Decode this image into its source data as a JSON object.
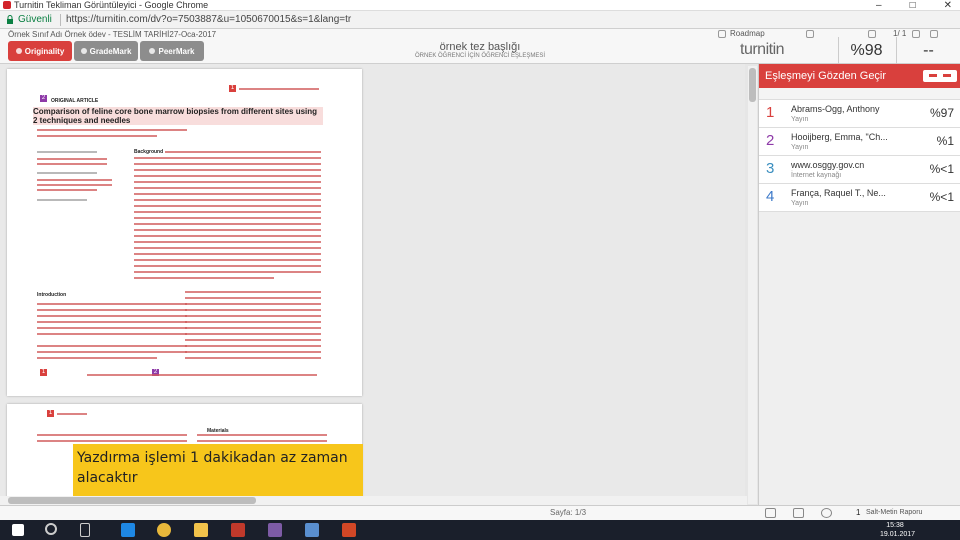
{
  "browser": {
    "window_title": "Turnitin Tekliman Görüntüleyici - Google Chrome",
    "secure_label": "Güvenli",
    "url": "https://turnitin.com/dv?o=7503887&u=1050670015&s=1&lang=tr"
  },
  "header": {
    "meta": "Örnek Sınıf Adı    Örnek ödev - TESLİM TARİHİ27-Oca-2017",
    "tabs": [
      {
        "label": "Originality",
        "active": true
      },
      {
        "label": "GradeMark",
        "active": false
      },
      {
        "label": "PeerMark",
        "active": false
      }
    ],
    "doc_title": "örnek tez başlığı",
    "doc_subtitle": "ÖRNEK ÖĞRENCİ İÇİN ÖĞRENCİ EŞLEŞMESİ",
    "roadmap_label": "Roadmap",
    "page_indicator": "1/ 1",
    "logo": "turnitin",
    "similarity_score": "%98",
    "grade": "--"
  },
  "document": {
    "article_label": "ORIGINAL ARTICLE",
    "title": "Comparison of feline core bone marrow biopsies from different sites using 2 techniques and needles",
    "intro_heading": "Introduction",
    "summary_label": "Background",
    "page2_section": "Materials"
  },
  "caption": {
    "text": "Yazdırma işlemi 1 dakikadan az zaman alacaktır"
  },
  "panel": {
    "title": "Eşleşmeyi Gözden Geçir",
    "matches": [
      {
        "num": "1",
        "name": "Abrams-Ogg, Anthony",
        "type": "Yayın",
        "pct": "%97",
        "color": "#d9403d"
      },
      {
        "num": "2",
        "name": "Hooijberg, Emma, \"Ch...",
        "type": "Yayın",
        "pct": "%1",
        "color": "#8e3aa8"
      },
      {
        "num": "3",
        "name": "www.osggy.gov.cn",
        "type": "İnternet kaynağı",
        "pct": "%<1",
        "color": "#3a8ebf"
      },
      {
        "num": "4",
        "name": "França, Raquel T., Ne...",
        "type": "Yayın",
        "pct": "%<1",
        "color": "#3c79c9"
      }
    ]
  },
  "bottom": {
    "zoom": "Sayfa: 1/3",
    "text_only_label": "Salt-Metin Raporu",
    "page_num": "1"
  },
  "taskbar": {
    "time": "15:38",
    "date": "19.01.2017"
  }
}
